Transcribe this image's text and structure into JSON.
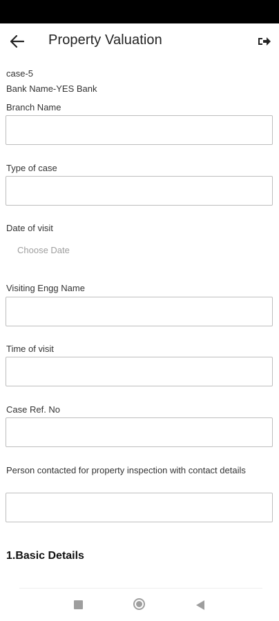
{
  "app_bar": {
    "title": "Property Valuation",
    "back_icon": "arrow-left-icon",
    "logout_icon": "logout-icon"
  },
  "case_info": {
    "case_id": "case-5",
    "bank_name": "Bank Name-YES Bank"
  },
  "form": {
    "branch_name": {
      "label": "Branch Name",
      "value": ""
    },
    "type_of_case": {
      "label": "Type of case",
      "value": ""
    },
    "date_of_visit": {
      "label": "Date of visit",
      "placeholder": "Choose Date"
    },
    "visiting_engg_name": {
      "label": "Visiting Engg Name",
      "value": ""
    },
    "time_of_visit": {
      "label": "Time of visit",
      "value": ""
    },
    "case_ref_no": {
      "label": "Case Ref. No",
      "value": ""
    },
    "person_contacted": {
      "label": "Person contacted for property inspection with contact details",
      "value": ""
    }
  },
  "section": {
    "basic_details": "1.Basic Details"
  },
  "colors": {
    "status_bar": "#000000",
    "border": "#bdbdbd",
    "placeholder": "#9e9e9e",
    "nav_icons": "#9e9e9e"
  }
}
